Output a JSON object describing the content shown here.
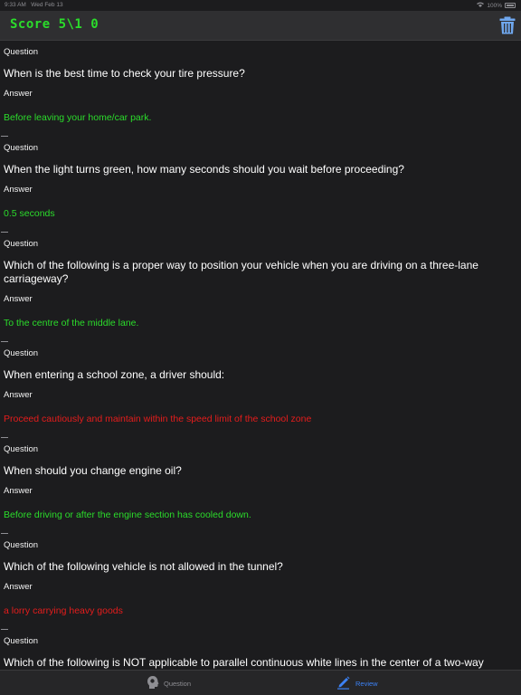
{
  "status": {
    "time": "9:33 AM",
    "date": "Wed Feb 13",
    "battery": "100%"
  },
  "header": {
    "score": "Score 5\\1 0"
  },
  "labels": {
    "question": "Question",
    "answer": "Answer"
  },
  "items": [
    {
      "question": "When is the best time to check your tire pressure?",
      "answer": "Before leaving your home/car park.",
      "status": "correct"
    },
    {
      "question": "When the light turns green, how many seconds should you wait before proceeding?",
      "answer": "0.5 seconds",
      "status": "correct"
    },
    {
      "question": "Which of the following is a proper way to position your vehicle when you are driving on a three-lane carriageway?",
      "answer": "To the centre of the middle lane.",
      "status": "correct"
    },
    {
      "question": "When entering a school zone, a driver should:",
      "answer": "Proceed cautiously and maintain within the speed limit of the school zone",
      "status": "wrong"
    },
    {
      "question": "When should you change engine oil?",
      "answer": "Before driving or after the engine section has cooled down.",
      "status": "correct"
    },
    {
      "question": "Which of the following vehicle is not allowed in the tunnel?",
      "answer": "a lorry carrying heavy goods",
      "status": "wrong"
    },
    {
      "question": "Which of the following is NOT applicable to parallel continuous white lines in the center of a two-way road?",
      "answer": "",
      "status": ""
    }
  ],
  "tabs": {
    "question": "Question",
    "review": "Review"
  },
  "colors": {
    "correct": "#2bdc2b",
    "wrong": "#e51c1c",
    "active_tab": "#3c82f6"
  }
}
